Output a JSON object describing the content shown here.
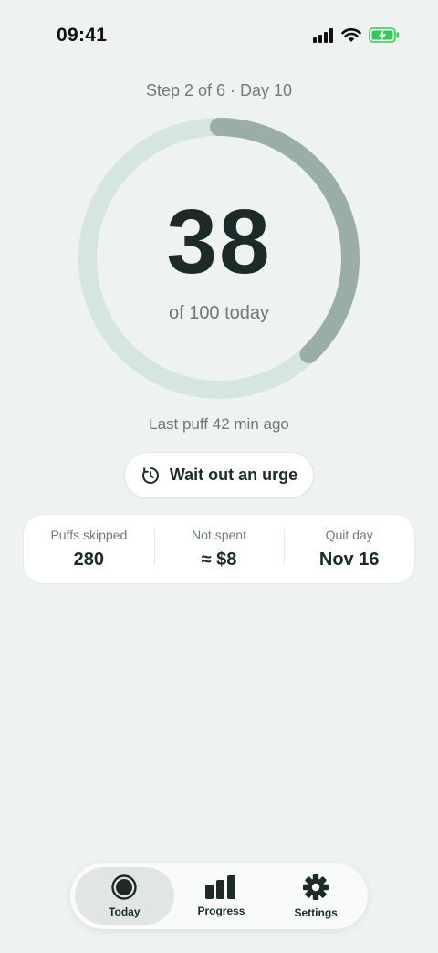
{
  "status_bar": {
    "time": "09:41",
    "battery_color": "#34c759"
  },
  "header": {
    "step_label": "Step 2 of 6 · Day 10"
  },
  "ring": {
    "count": "38",
    "subtitle": "of 100 today",
    "progress_fraction": 0.38,
    "track_color": "#d5e6e0",
    "fill_color": "#99aea6"
  },
  "last_puff": "Last puff 42 min ago",
  "urge_button": {
    "label": "Wait out an urge",
    "icon": "timer-icon"
  },
  "stats": [
    {
      "label": "Puffs skipped",
      "value": "280"
    },
    {
      "label": "Not spent",
      "value": "≈ $8"
    },
    {
      "label": "Quit day",
      "value": "Nov 16"
    }
  ],
  "tabbar": {
    "tabs": [
      {
        "label": "Today",
        "icon": "ring-icon",
        "active": true
      },
      {
        "label": "Progress",
        "icon": "bar-chart-icon",
        "active": false
      },
      {
        "label": "Settings",
        "icon": "gear-icon",
        "active": false
      }
    ]
  }
}
